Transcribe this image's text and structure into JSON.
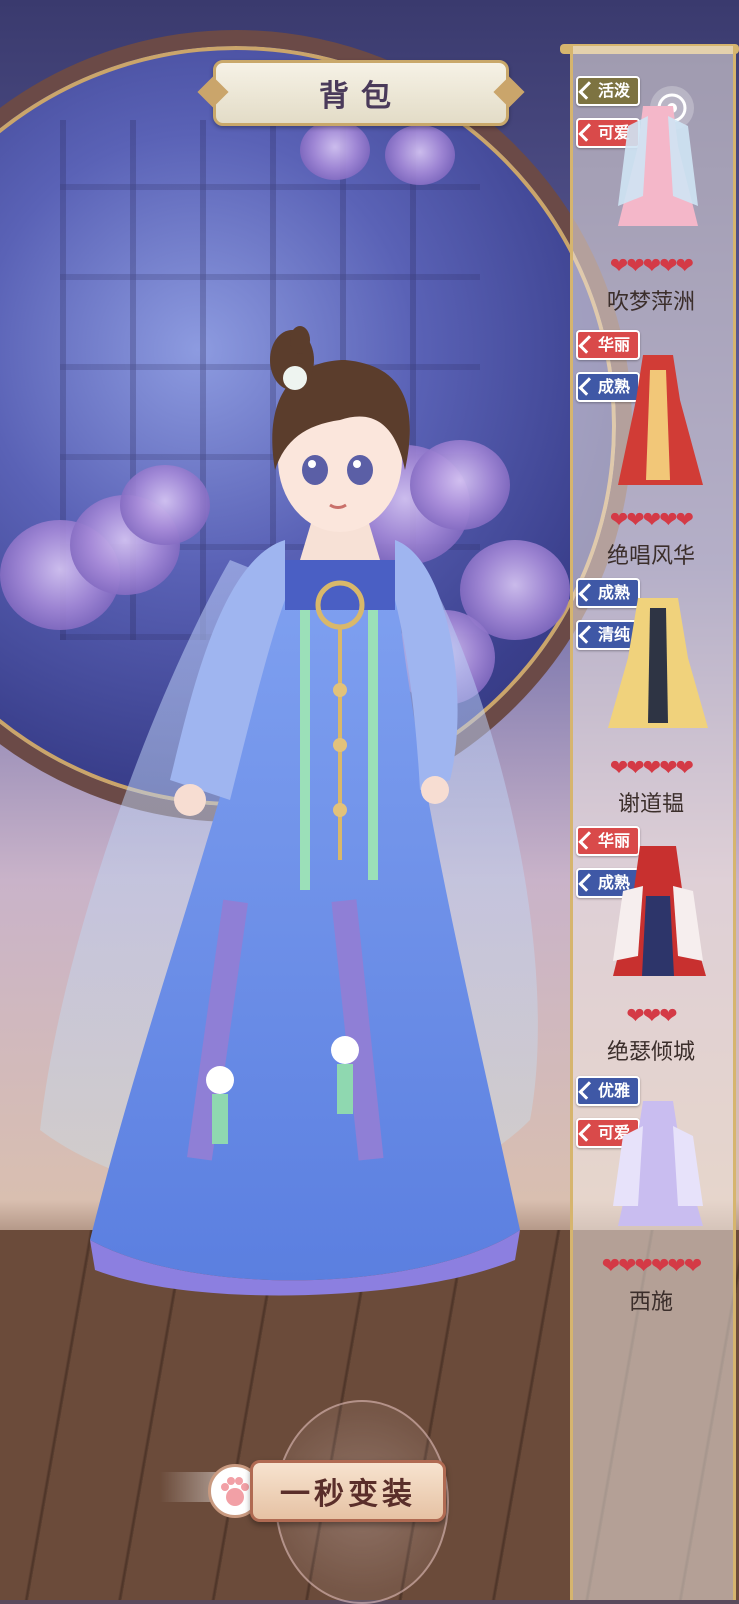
{
  "header": {
    "title": "背包"
  },
  "panel": {
    "items": [
      {
        "tags": [
          "活泼",
          "可爱"
        ],
        "tag_colors": [
          "olive",
          "red"
        ],
        "hearts": "❤❤❤❤❤",
        "name": "吹梦萍洲"
      },
      {
        "tags": [
          "华丽",
          "成熟"
        ],
        "tag_colors": [
          "red",
          "blue"
        ],
        "hearts": "❤❤❤❤❤",
        "name": "绝唱风华"
      },
      {
        "tags": [
          "成熟",
          "清纯"
        ],
        "tag_colors": [
          "blue",
          "blue"
        ],
        "hearts": "❤❤❤❤❤",
        "name": "谢道韫"
      },
      {
        "tags": [
          "华丽",
          "成熟"
        ],
        "tag_colors": [
          "red",
          "blue"
        ],
        "hearts": "❤❤❤",
        "name": "绝瑟倾城"
      },
      {
        "tags": [
          "优雅",
          "可爱"
        ],
        "tag_colors": [
          "blue",
          "red"
        ],
        "hearts": "❤❤❤❤❤❤",
        "name": "西施"
      }
    ]
  },
  "footer": {
    "switch_button": "一秒变装"
  },
  "icons": {
    "record": "record-icon",
    "paw": "paw-icon"
  },
  "colors": {
    "heart": "#d43a46",
    "tag_red": "#d94a4a",
    "tag_blue": "#3f58a6",
    "gold": "#d6b56e"
  }
}
